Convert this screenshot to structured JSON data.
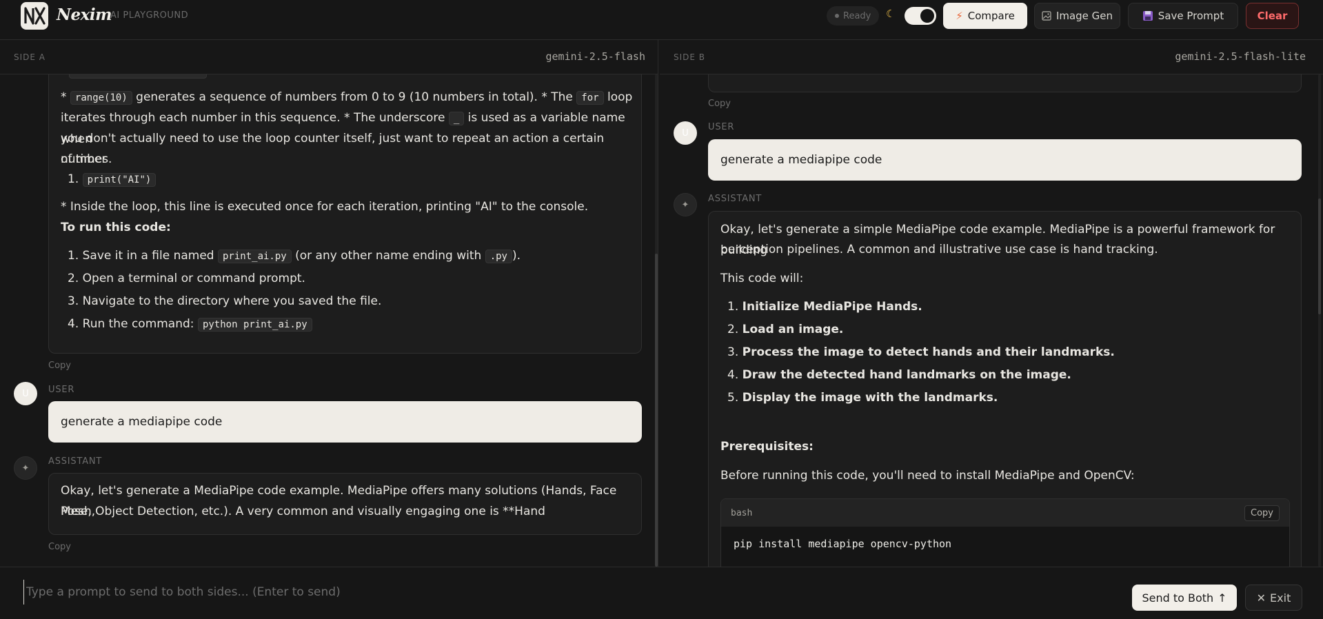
{
  "header": {
    "brand": "Nexim",
    "subtitle": "AI PLAYGROUND",
    "status": "Ready",
    "compare_label": "Compare",
    "image_gen_label": "Image Gen",
    "save_prompt_label": "Save Prompt",
    "clear_label": "Clear"
  },
  "side_a": {
    "label": "SIDE A",
    "model": "gemini-2.5-flash",
    "prev_answer": {
      "line1_a": "* ",
      "code_range": "range(10)",
      "line1_b": " generates a sequence of numbers from 0 to 9 (10 numbers in total). * The ",
      "code_for": "for",
      "line1_c": " loop",
      "line2_a": "iterates through each number in this sequence. * The underscore ",
      "code_underscore": "_",
      "line2_b": " is used as a variable name when",
      "line3": "you don't actually need to use the loop counter itself, just want to repeat an action a certain number",
      "line4": "of times.",
      "list_num": "1.",
      "code_print": "print(\"AI\")",
      "inside_loop": "* Inside the loop, this line is executed once for each iteration, printing \"AI\" to the console.",
      "to_run": "To run this code:",
      "steps": [
        {
          "num": "1.",
          "a": "Save it in a file named ",
          "code": "print_ai.py",
          "b": " (or any other name ending with ",
          "code2": ".py",
          "c": ")."
        },
        {
          "num": "2.",
          "a": "Open a terminal or command prompt."
        },
        {
          "num": "3.",
          "a": "Navigate to the directory where you saved the file."
        },
        {
          "num": "4.",
          "a": "Run the command: ",
          "code": "python print_ai.py"
        }
      ]
    },
    "copy_label": "Copy",
    "user_role": "USER",
    "user_avatar": "U",
    "user_message": "generate a mediapipe code",
    "assistant_role": "ASSISTANT",
    "assistant_line1": "Okay, let's generate a MediaPipe code example. MediaPipe offers many solutions (Hands, Face Mesh,",
    "assistant_line2": "Pose, Object Detection, etc.). A very common and visually engaging one is **Hand",
    "copy_label_2": "Copy"
  },
  "side_b": {
    "label": "SIDE B",
    "model": "gemini-2.5-flash-lite",
    "copy_label": "Copy",
    "user_role": "USER",
    "user_avatar": "U",
    "user_message": "generate a mediapipe code",
    "assistant_role": "ASSISTANT",
    "intro_line1": "Okay, let's generate a simple MediaPipe code example. MediaPipe is a powerful framework for building",
    "intro_line2": "perception pipelines. A common and illustrative use case is hand tracking.",
    "code_will": "This code will:",
    "steps": [
      {
        "num": "1.",
        "text": "Initialize MediaPipe Hands."
      },
      {
        "num": "2.",
        "text": "Load an image."
      },
      {
        "num": "3.",
        "text": "Process the image to detect hands and their landmarks."
      },
      {
        "num": "4.",
        "text": "Draw the detected hand landmarks on the image."
      },
      {
        "num": "5.",
        "text": "Display the image with the landmarks."
      }
    ],
    "prereq_title": "Prerequisites:",
    "prereq_text": "Before running this code, you'll need to install MediaPipe and OpenCV:",
    "codeblock": {
      "lang": "bash",
      "copy_label": "Copy",
      "code": "pip install mediapipe opencv-python"
    }
  },
  "input": {
    "placeholder": "Type a prompt to send to both sides... (Enter to send)",
    "value": ""
  },
  "footer": {
    "send_label": "Send to Both",
    "exit_label": "Exit"
  },
  "colors": {
    "background": "#171717",
    "accent_light": "#efece6",
    "danger": "#ff6b6b",
    "moon": "#f0c04a"
  }
}
